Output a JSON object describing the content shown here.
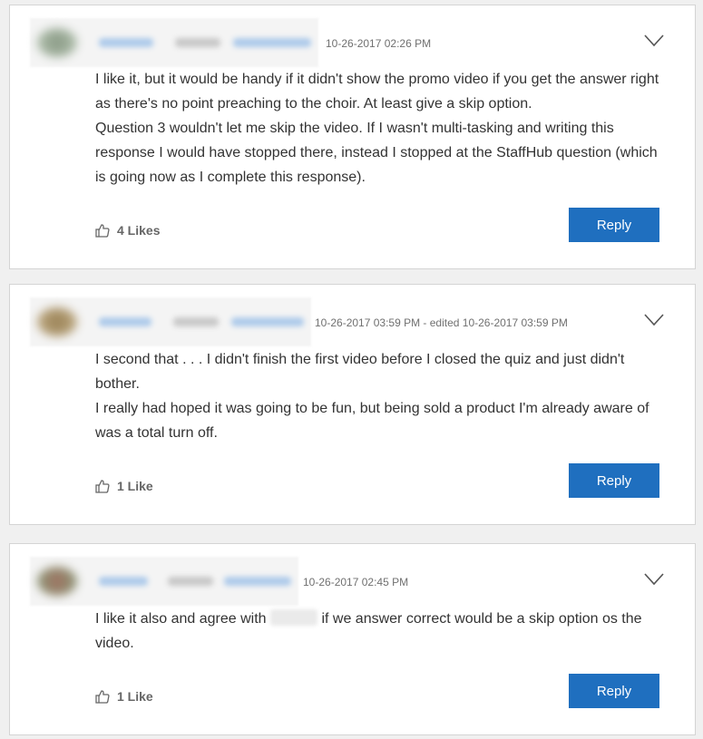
{
  "posts": [
    {
      "timestamp": "10-26-2017 02:26 PM",
      "body": [
        "I like it, but it would be handy if it didn't show the promo video if you get the answer right as there's no point preaching to the choir. At least give a skip option.",
        "Question 3 wouldn't let me skip the video. If I wasn't multi-tasking and writing this response I would have stopped there, instead I stopped at the StaffHub question (which is going now as I complete this response)."
      ],
      "likes_label": "4 Likes",
      "reply_label": "Reply"
    },
    {
      "timestamp": "10-26-2017 03:59 PM - edited 10-26-2017 03:59 PM",
      "body": [
        "I second that . . . I didn't finish the first video before I closed the quiz and just didn't bother.",
        "I really had hoped it was going to be fun, but being sold a product I'm already aware of was a total turn off."
      ],
      "likes_label": "1 Like",
      "reply_label": "Reply"
    },
    {
      "timestamp": "10-26-2017 02:45 PM",
      "body_before_mention": "I like it also and agree with",
      "body_after_mention": "if we answer correct would be a skip option os the video.",
      "likes_label": "1 Like",
      "reply_label": "Reply"
    }
  ],
  "colors": {
    "reply_button": "#1f6fbf",
    "card_border": "#d4d4d4",
    "page_background": "#f0f0f0"
  },
  "icons": [
    "chevron-down-icon",
    "thumbs-up-icon"
  ]
}
